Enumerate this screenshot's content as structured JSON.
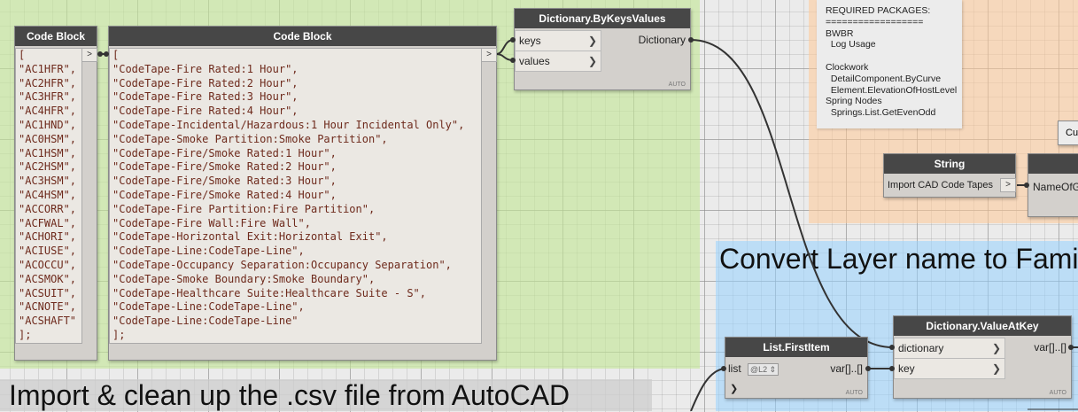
{
  "groups": {
    "import_title": "Import & clean up the .csv file from AutoCAD",
    "convert_title": "Convert Layer name to Fami"
  },
  "code_block_left": {
    "title": "Code Block",
    "output_label": ">",
    "lines": [
      "[",
      "\"AC1HFR\",",
      "\"AC2HFR\",",
      "\"AC3HFR\",",
      "\"AC4HFR\",",
      "\"AC1HND\",",
      "\"AC0HSM\",",
      "\"AC1HSM\",",
      "\"AC2HSM\",",
      "\"AC3HSM\",",
      "\"AC4HSM\",",
      "\"ACCORR\",",
      "\"ACFWAL\",",
      "\"ACHORI\",",
      "\"ACIUSE\",",
      "\"ACOCCU\",",
      "\"ACSMOK\",",
      "\"ACSUIT\",",
      "\"ACNOTE\",",
      "\"ACSHAFT\"",
      "];"
    ]
  },
  "code_block_right": {
    "title": "Code Block",
    "output_label": ">",
    "lines": [
      "[",
      "\"CodeTape-Fire Rated:1 Hour\",",
      "\"CodeTape-Fire Rated:2 Hour\",",
      "\"CodeTape-Fire Rated:3 Hour\",",
      "\"CodeTape-Fire Rated:4 Hour\",",
      "\"CodeTape-Incidental/Hazardous:1 Hour Incidental Only\",",
      "\"CodeTape-Smoke Partition:Smoke Partition\",",
      "\"CodeTape-Fire/Smoke Rated:1 Hour\",",
      "\"CodeTape-Fire/Smoke Rated:2 Hour\",",
      "\"CodeTape-Fire/Smoke Rated:3 Hour\",",
      "\"CodeTape-Fire/Smoke Rated:4 Hour\",",
      "\"CodeTape-Fire Partition:Fire Partition\",",
      "\"CodeTape-Fire Wall:Fire Wall\",",
      "\"CodeTape-Horizontal Exit:Horizontal Exit\",",
      "\"CodeTape-Line:CodeTape-Line\",",
      "\"CodeTape-Occupancy Separation:Occupancy Separation\",",
      "\"CodeTape-Smoke Boundary:Smoke Boundary\",",
      "\"CodeTape-Healthcare Suite:Healthcare Suite - S\",",
      "\"CodeTape-Line:CodeTape-Line\",",
      "\"CodeTape-Line:CodeTape-Line\"",
      "];"
    ]
  },
  "dict_by_keys": {
    "title": "Dictionary.ByKeysValues",
    "in_keys": "keys",
    "in_values": "values",
    "out": "Dictionary",
    "lacing": "AUTO"
  },
  "notes": {
    "lines": [
      "REQUIRED PACKAGES:",
      "==================",
      "BWBR",
      "  Log Usage",
      "",
      "Clockwork",
      "  DetailComponent.ByCurve",
      "  Element.ElevationOfHostLevel",
      "Spring Nodes",
      "  Springs.List.GetEvenOdd"
    ]
  },
  "partial_node": {
    "label": "Cu"
  },
  "string_node": {
    "title": "String",
    "value": "Import CAD Code Tapes",
    "output_label": ">"
  },
  "partial_node_right": {
    "label": "NameOfG"
  },
  "list_first": {
    "title": "List.FirstItem",
    "in_list": "list",
    "level": "@L2",
    "out": "var[]..[]",
    "lacing": "AUTO"
  },
  "dict_value_at_key": {
    "title": "Dictionary.ValueAtKey",
    "in_dictionary": "dictionary",
    "in_key": "key",
    "out": "var[]..[]",
    "lacing": "AUTO"
  },
  "colors": {
    "node_header": "#474747",
    "node_body": "#d3d0cc",
    "code_text": "#6e2a1c",
    "group_green": "#c4e696",
    "group_orange": "#ffc896",
    "group_blue": "#96d2ff",
    "group_grey": "#cdcdcd"
  },
  "icons": {
    "port_arrow": "chevron-right-icon",
    "level_spinner": "stepper-icon"
  }
}
